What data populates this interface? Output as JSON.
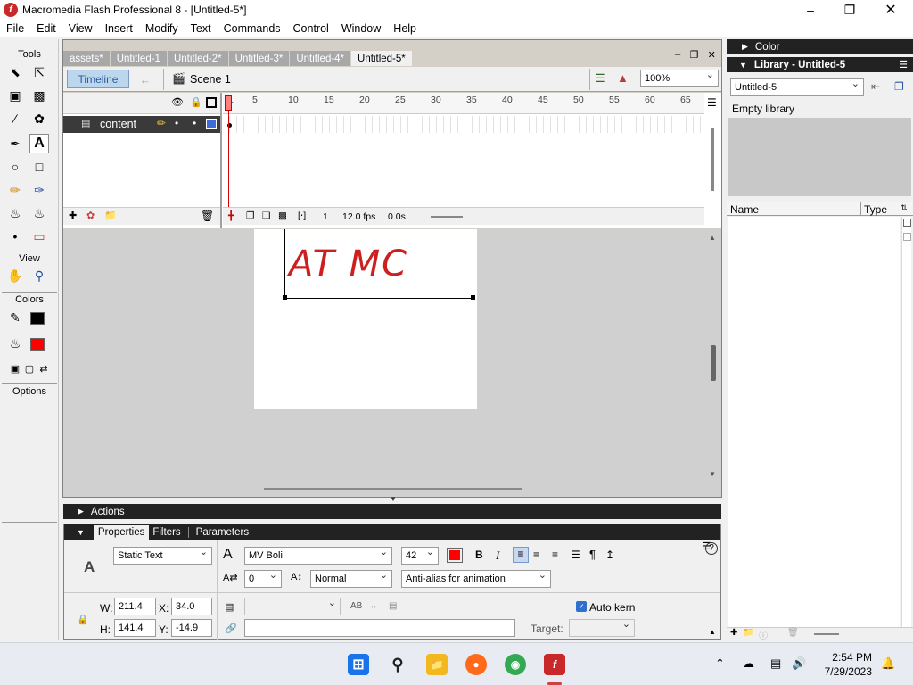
{
  "window": {
    "title": "Macromedia Flash Professional 8 - [Untitled-5*]",
    "logo_letter": "f"
  },
  "menu": [
    "File",
    "Edit",
    "View",
    "Insert",
    "Modify",
    "Text",
    "Commands",
    "Control",
    "Window",
    "Help"
  ],
  "tools": {
    "title": "Tools",
    "view_label": "View",
    "colors_label": "Colors",
    "options_label": "Options",
    "stroke_color": "#000000",
    "fill_color": "#ff0000"
  },
  "doc_tabs": [
    "assets*",
    "Untitled-1",
    "Untitled-2*",
    "Untitled-3*",
    "Untitled-4*",
    "Untitled-5*"
  ],
  "timeline_bar": {
    "timeline_label": "Timeline",
    "scene": "Scene 1",
    "zoom": "100%"
  },
  "timeline": {
    "layer_name": "content",
    "ruler": [
      "1",
      "5",
      "10",
      "15",
      "20",
      "25",
      "30",
      "35",
      "40",
      "45",
      "50",
      "55",
      "60",
      "65"
    ],
    "current_frame": "1",
    "fps": "12.0 fps",
    "time": "0.0s"
  },
  "stage": {
    "text": "AT MC",
    "text_color": "#cc1f1f"
  },
  "actions_label": "Actions",
  "properties": {
    "tabs": [
      "Properties",
      "Filters",
      "Parameters"
    ],
    "text_type": "Static Text",
    "font": "MV Boli",
    "size": "42",
    "text_color": "#ff0000",
    "bold": "B",
    "italic": "I",
    "letter_spacing": "0",
    "baseline": "Normal",
    "antialias": "Anti-alias for animation",
    "w_label": "W:",
    "w": "211.4",
    "x_label": "X:",
    "x": "34.0",
    "h_label": "H:",
    "h": "141.4",
    "y_label": "Y:",
    "y": "-14.9",
    "auto_kern": "Auto kern",
    "target_label": "Target:",
    "paragraph_mark": "¶",
    "help": "?"
  },
  "right_panel": {
    "color_label": "Color",
    "library_label": "Library - Untitled-5",
    "library_select": "Untitled-5",
    "empty_text": "Empty library",
    "col_name": "Name",
    "col_type": "Type"
  },
  "taskbar": {
    "time": "2:54 PM",
    "date": "7/29/2023"
  }
}
